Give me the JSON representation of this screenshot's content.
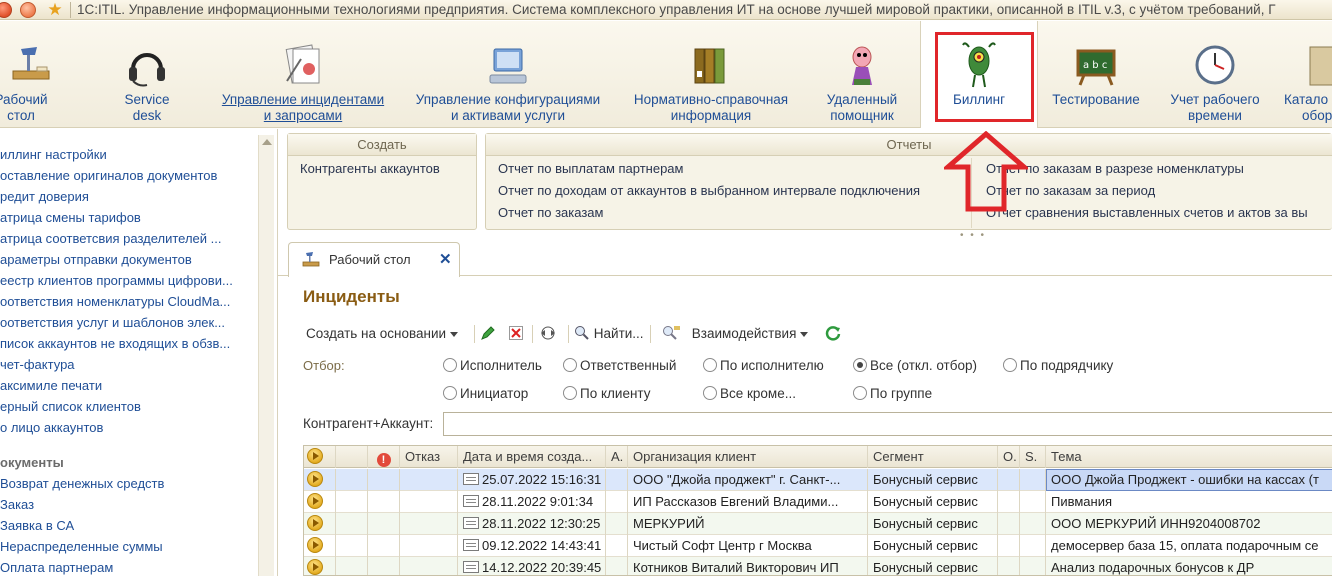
{
  "window": {
    "title": "1С:ITIL. Управление информационными технологиями предприятия. Система комплексного управления ИТ на основе лучшей мировой практики, описанной в ITIL v.3, с учётом требований, Г"
  },
  "sections": [
    {
      "label1": "Рабочий",
      "label2": "стол",
      "icon": "desk-lamp-icon"
    },
    {
      "label1": "Service",
      "label2": "desk",
      "icon": "headset-icon"
    },
    {
      "label1": "Управление инцидентами",
      "label2": "и запросами",
      "icon": "incident-documents-icon"
    },
    {
      "label1": "Управление конфигурациями",
      "label2": "и активами услуги",
      "icon": "configuration-icon"
    },
    {
      "label1": "Нормативно-справочная",
      "label2": "информация",
      "icon": "binders-icon"
    },
    {
      "label1": "Удаленный",
      "label2": "помощник",
      "icon": "cartoon-helper-icon"
    },
    {
      "label1": "Биллинг",
      "label2": "",
      "icon": "plankton-icon"
    },
    {
      "label1": "Тестирование",
      "label2": "",
      "icon": "chalkboard-icon"
    },
    {
      "label1": "Учет рабочего",
      "label2": "времени",
      "icon": "clock-icon"
    },
    {
      "label1": "Катало",
      "label2": "обор",
      "icon": "catalog-icon"
    }
  ],
  "leftnav": {
    "items": [
      "иллинг настройки",
      "оставление оригиналов документов",
      "редит доверия",
      "атрица смены тарифов",
      "атрица соответсвия разделителей ...",
      "араметры отправки документов",
      "еестр клиентов программы цифрови...",
      "оответствия номенклатуры CloudMa...",
      "оответствия услуг и шаблонов элек...",
      "писок аккаунтов не входящих в обзв...",
      "чет-фактура",
      "акcимиле печати",
      "ерный список клиентов",
      "о лицо аккаунтов"
    ],
    "group_title": "окументы",
    "doc_items": [
      "Возврат денежных средств",
      "Заказ",
      "Заявка в СА",
      "Нераспределенные суммы",
      "Оплата партнерам"
    ]
  },
  "create_panel": {
    "title": "Создать",
    "items": [
      "Контрагенты аккаунтов"
    ]
  },
  "reports_panel": {
    "title": "Отчеты",
    "col1": [
      "Отчет по выплатам партнерам",
      "Отчет по доходам от аккаунтов в выбранном интервале подключения",
      "Отчет по заказам"
    ],
    "col2": [
      "Отчет по заказам в разрезе номенклатуры",
      "Отчет по заказам за период",
      "Отчет сравнения выставленных счетов и актов за вы"
    ]
  },
  "tab": {
    "label": "Рабочий стол",
    "close": "✕"
  },
  "content": {
    "title": "Инциденты",
    "toolbar": {
      "create_based": "Создать на основании",
      "find": "Найти...",
      "interactions": "Взаимодействия"
    },
    "filter": {
      "label": "Отбор:",
      "options": [
        {
          "label": "Исполнитель",
          "selected": false
        },
        {
          "label": "Ответственный",
          "selected": false
        },
        {
          "label": "По исполнителю",
          "selected": false
        },
        {
          "label": "Все (откл. отбор)",
          "selected": true
        },
        {
          "label": "По подрядчику",
          "selected": false
        },
        {
          "label": "Инициатор",
          "selected": false
        },
        {
          "label": "По клиенту",
          "selected": false
        },
        {
          "label": "Все кроме...",
          "selected": false
        },
        {
          "label": "По группе",
          "selected": false
        }
      ]
    },
    "kontragent_label": "Контрагент+Аккаунт:",
    "kontragent_value": ""
  },
  "table": {
    "columns": [
      "",
      "",
      "",
      "Отказ",
      "Дата и время созда...",
      "А.",
      "Организация клиент",
      "Сегмент",
      "О.",
      "S.",
      "Тема"
    ],
    "rows": [
      {
        "date": "25.07.2022 15:16:31",
        "org": "ООО \"Джойа проджект\" г. Санкт-...",
        "segment": "Бонусный сервис",
        "topic": "ООО Джойа Проджект - ошибки на кассах (т"
      },
      {
        "date": "28.11.2022 9:01:34",
        "org": "ИП Рассказов Евгений Владими...",
        "segment": "Бонусный сервис",
        "topic": "Пивмания"
      },
      {
        "date": "28.11.2022 12:30:25",
        "org": "МЕРКУРИЙ",
        "segment": "Бонусный сервис",
        "topic": "ООО МЕРКУРИЙ ИНН9204008702"
      },
      {
        "date": "09.12.2022 14:43:41",
        "org": "Чистый Софт Центр г Москва",
        "segment": "Бонусный сервис",
        "topic": "демосервер база 15, оплата подарочным се"
      },
      {
        "date": "14.12.2022 20:39:45",
        "org": "Котников Виталий Викторович ИП",
        "segment": "Бонусный сервис",
        "topic": "Анализ подарочных бонусов к ДР"
      }
    ]
  },
  "colors": {
    "accent_red": "#e0262a",
    "link_blue": "#1f4e96",
    "title_brown": "#8a5c13"
  }
}
